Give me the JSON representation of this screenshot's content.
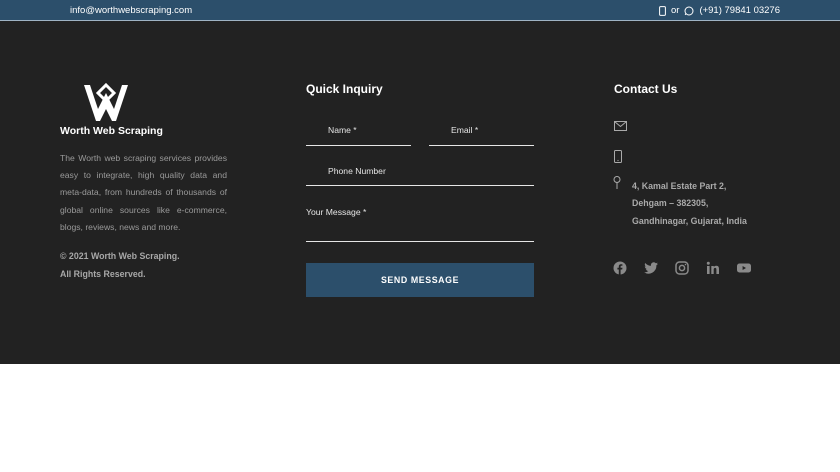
{
  "topbar": {
    "email": "info@worthwebscraping.com",
    "or": "or",
    "phone": "(+91) 79841 03276",
    "icons": [
      "mobile-icon",
      "whatsapp-icon"
    ]
  },
  "brand": {
    "name": "Worth Web Scraping",
    "about": "The Worth web scraping services provides easy to integrate, high quality data and meta-data, from hundreds of thousands of global online sources like e-commerce, blogs, reviews, news and more.",
    "copyright": "© 2021 Worth Web Scraping.",
    "rights": "All Rights Reserved."
  },
  "inquiry": {
    "title": "Quick Inquiry",
    "name_label": "Name *",
    "email_label": "Email *",
    "phone_label": "Phone Number",
    "message_label": "Your Message *",
    "submit": "SEND MESSAGE"
  },
  "contact": {
    "title": "Contact Us",
    "address_line1": "4, Kamal Estate Part 2,",
    "address_line2": "Dehgam – 382305,",
    "address_line3": "Gandhinagar, Gujarat, India",
    "social": [
      "facebook-icon",
      "twitter-icon",
      "instagram-icon",
      "linkedin-icon",
      "youtube-icon"
    ]
  },
  "colors": {
    "accent": "#2c4f6b",
    "footer_bg": "#222222"
  }
}
